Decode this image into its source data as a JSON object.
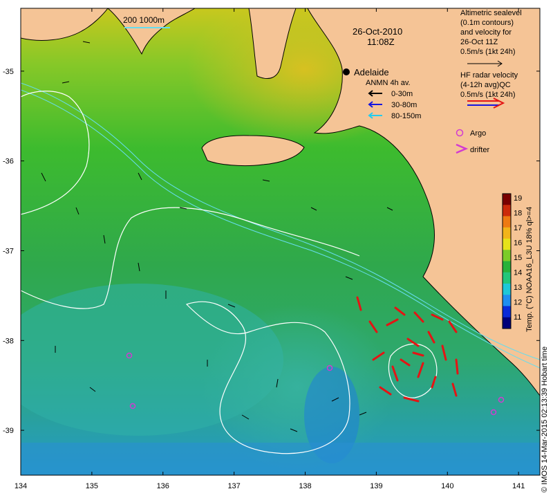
{
  "map": {
    "date": "26-Oct-2010",
    "time": "11:08Z",
    "scale_bar": "200  1000m",
    "city": "Adelaide",
    "y_ticks": [
      "-35",
      "-36",
      "-37",
      "-38",
      "-39"
    ],
    "x_ticks": [
      "134",
      "135",
      "136",
      "137",
      "138",
      "139",
      "140",
      "141"
    ],
    "lon_range": [
      134,
      141.3
    ],
    "lat_range": [
      -39.5,
      -34.3
    ]
  },
  "legend": {
    "altimetry": [
      "Altimetric sealevel",
      "(0.1m contours)",
      "and velocity for",
      "26-Oct 11Z",
      "0.5m/s (1kt 24h)"
    ],
    "hf_radar": [
      "HF radar velocity",
      "(4-12h avg)QC",
      "0.5m/s (1kt 24h)"
    ],
    "anmn_title": "ANMN 4h av.",
    "anmn_items": [
      {
        "label": "0-30m",
        "color": "#000000"
      },
      {
        "label": "30-80m",
        "color": "#1515e0"
      },
      {
        "label": "80-150m",
        "color": "#22ccee"
      }
    ],
    "argo": "Argo",
    "drifter": "drifter",
    "argo_color": "#d23ad2",
    "radar_color": "#e41414"
  },
  "colorbar": {
    "title": "Temp. (°C) NOAA16_L3U 18% ql>=4",
    "ticks": [
      "11",
      "12",
      "13",
      "14",
      "15",
      "16",
      "17",
      "18",
      "19"
    ],
    "colors": [
      "#00007a",
      "#0a2ad8",
      "#1f8ef0",
      "#1ec8d8",
      "#22c77a",
      "#27b23a",
      "#7ccc28",
      "#e6e21a",
      "#f2b41a",
      "#ee7a12",
      "#cc2a0a",
      "#7a0000"
    ]
  },
  "colors": {
    "land": "#f5c496",
    "coast": "#000000",
    "contour": "#ffffff",
    "shelf": "#66ddee"
  },
  "credit": "© IMOS 14-Mar-2015 02:13:39 Hobart time"
}
